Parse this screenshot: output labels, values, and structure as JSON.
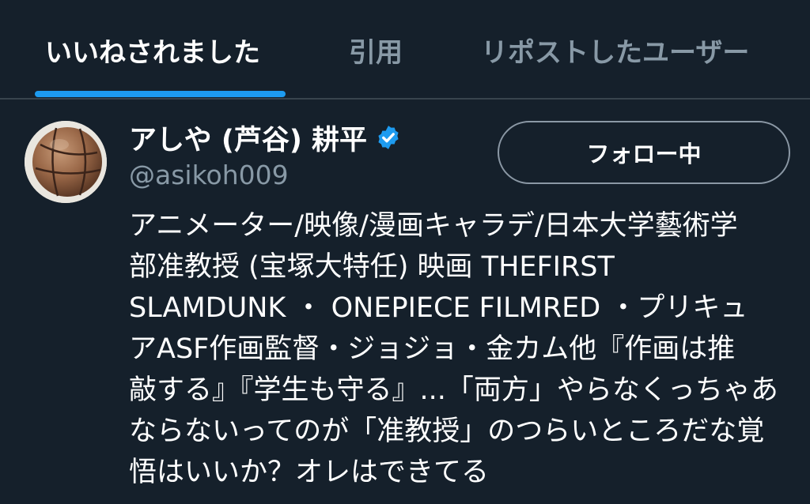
{
  "tabs": {
    "likes": "いいねされました",
    "quotes": "引用",
    "reposts": "リポストしたユーザー",
    "active": "likes"
  },
  "accent_color": "#1d9bf0",
  "background_color": "#15202b",
  "user": {
    "display_name": "アしや (芦谷) 耕平",
    "handle": "@asikoh009",
    "verified": true,
    "avatar_icon": "basketball-avatar",
    "follow_button_label": "フォロー中",
    "bio_lines": [
      "アニメーター/映像/漫画キャラデ/日本大学藝術学",
      "部准教授 (宝塚大特任) 映画 THEFIRST",
      "SLAMDUNK ・ ONEPIECE FILMRED ・プリキュ",
      "アASF作画監督・ジョジョ・金カム他『作画は推",
      "敲する』『学生も守る』...「両方」やらなくっちゃあ",
      "ならないってのが「准教授」のつらいところだな覚",
      "悟はいいか？オレはできてる"
    ]
  }
}
